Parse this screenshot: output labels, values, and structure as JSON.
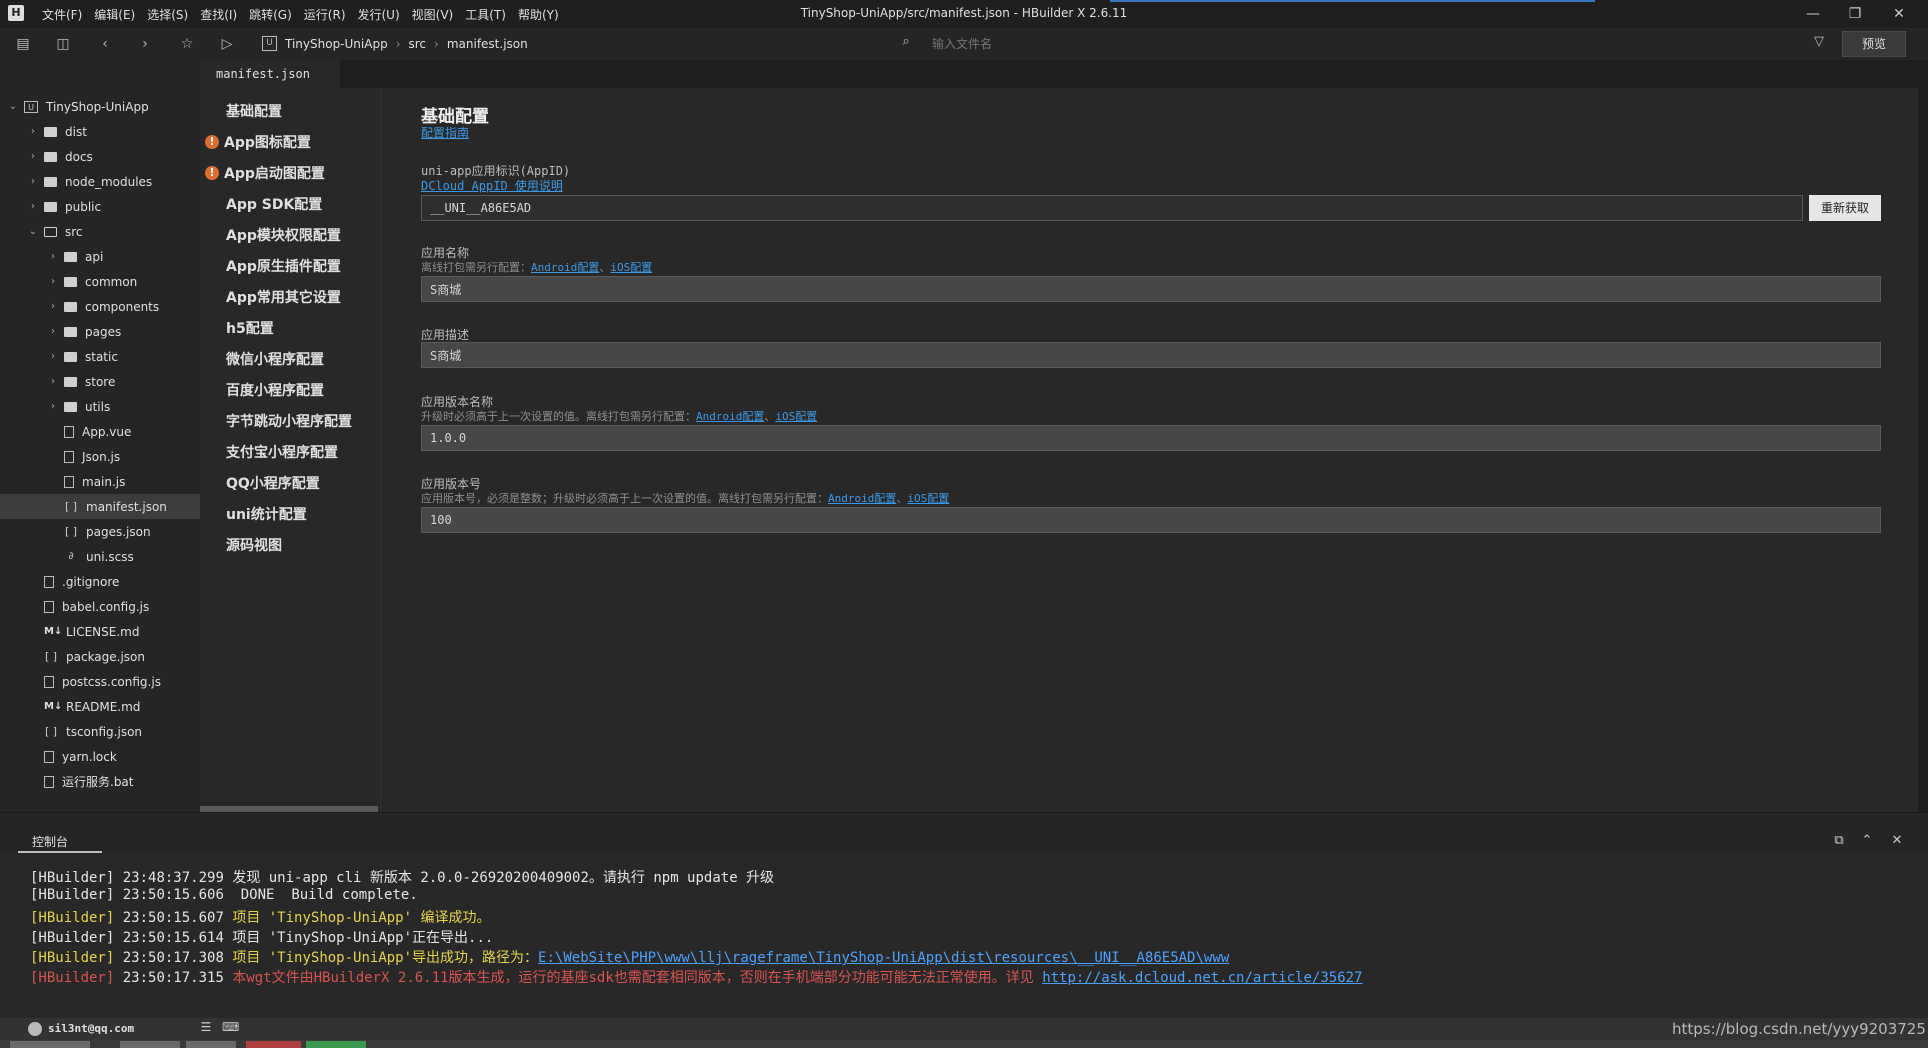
{
  "window": {
    "title": "TinyShop-UniApp/src/manifest.json - HBuilder X 2.6.11",
    "menu": [
      "文件(F)",
      "编辑(E)",
      "选择(S)",
      "查找(I)",
      "跳转(G)",
      "运行(R)",
      "发行(U)",
      "视图(V)",
      "工具(T)",
      "帮助(Y)"
    ]
  },
  "toolbar": {
    "breadcrumb": [
      "TinyShop-UniApp",
      "src",
      "manifest.json"
    ],
    "file_search_placeholder": "输入文件名",
    "preview_label": "预览"
  },
  "tree": {
    "root": "TinyShop-UniApp",
    "items": [
      {
        "label": "dist"
      },
      {
        "label": "docs"
      },
      {
        "label": "node_modules"
      },
      {
        "label": "public"
      },
      {
        "label": "src"
      },
      {
        "label": "api"
      },
      {
        "label": "common"
      },
      {
        "label": "components"
      },
      {
        "label": "pages"
      },
      {
        "label": "static"
      },
      {
        "label": "store"
      },
      {
        "label": "utils"
      },
      {
        "label": "App.vue"
      },
      {
        "label": "Json.js"
      },
      {
        "label": "main.js"
      },
      {
        "label": "manifest.json"
      },
      {
        "label": "pages.json"
      },
      {
        "label": "uni.scss"
      },
      {
        "label": ".gitignore"
      },
      {
        "label": "babel.config.js"
      },
      {
        "label": "LICENSE.md"
      },
      {
        "label": "package.json"
      },
      {
        "label": "postcss.config.js"
      },
      {
        "label": "README.md"
      },
      {
        "label": "tsconfig.json"
      },
      {
        "label": "yarn.lock"
      },
      {
        "label": "运行服务.bat"
      }
    ]
  },
  "editor": {
    "tab_label": "manifest.json"
  },
  "settings_nav": [
    "基础配置",
    "App图标配置",
    "App启动图配置",
    "App SDK配置",
    "App模块权限配置",
    "App原生插件配置",
    "App常用其它设置",
    "h5配置",
    "微信小程序配置",
    "百度小程序配置",
    "字节跳动小程序配置",
    "支付宝小程序配置",
    "QQ小程序配置",
    "uni统计配置",
    "源码视图"
  ],
  "form": {
    "heading": "基础配置",
    "guide_link": "配置指南",
    "appid": {
      "label": "uni-app应用标识(AppID)",
      "link": "DCloud AppID 使用说明",
      "value": "__UNI__A86E5AD",
      "refetch_label": "重新获取"
    },
    "app_name": {
      "label": "应用名称",
      "hint": "离线打包需另行配置：",
      "link_android": "Android配置",
      "sep": "、",
      "link_ios": "iOS配置",
      "value": "S商城"
    },
    "app_desc": {
      "label": "应用描述",
      "value": "S商城"
    },
    "version_name": {
      "label": "应用版本名称",
      "hint": "升级时必须高于上一次设置的值。离线打包需另行配置：",
      "link_android": "Android配置",
      "sep": "、",
      "link_ios": "iOS配置",
      "value": "1.0.0"
    },
    "version_code": {
      "label": "应用版本号",
      "hint": "应用版本号，必须是整数；升级时必须高于上一次设置的值。离线打包需另行配置：",
      "link_android": "Android配置",
      "sep": "、",
      "link_ios": "iOS配置",
      "value": "100"
    }
  },
  "console": {
    "tab_label": "控制台",
    "lines": [
      {
        "prefix": "[HBuilder]",
        "time": "23:48:37.299",
        "text": "发现 uni-app cli 新版本 2.0.0-26920200409002。请执行 npm update 升级"
      },
      {
        "prefix": "[HBuilder]",
        "time": "23:50:15.606",
        "text": " DONE  Build complete."
      },
      {
        "prefix": "[HBuilder]",
        "time": "23:50:15.607",
        "text": "项目 'TinyShop-UniApp' 编译成功。"
      },
      {
        "prefix": "[HBuilder]",
        "time": "23:50:15.614",
        "text": "项目 'TinyShop-UniApp'正在导出..."
      },
      {
        "prefix": "[HBuilder]",
        "time": "23:50:17.308",
        "text": "项目 'TinyShop-UniApp'导出成功，路径为：",
        "link": "E:\\WebSite\\PHP\\www\\llj\\rageframe\\TinyShop-UniApp\\dist\\resources\\__UNI__A86E5AD\\www"
      },
      {
        "prefix": "[HBuilder]",
        "time": "23:50:17.315",
        "text": "本wgt文件由HBuilderX 2.6.11版本生成，运行的基座sdk也需配套相同版本，否则在手机端部分功能可能无法正常使用。详见 ",
        "link": "http://ask.dcloud.net.cn/article/35627"
      }
    ]
  },
  "statusbar": {
    "user": "sil3nt@qq.com",
    "watermark": "https://blog.csdn.net/yyy9203725"
  },
  "colors": {
    "accent_link": "#3a9ae8",
    "warning": "#e06c2e",
    "log_yellow": "#e5d44a",
    "log_red": "#d9534f"
  }
}
